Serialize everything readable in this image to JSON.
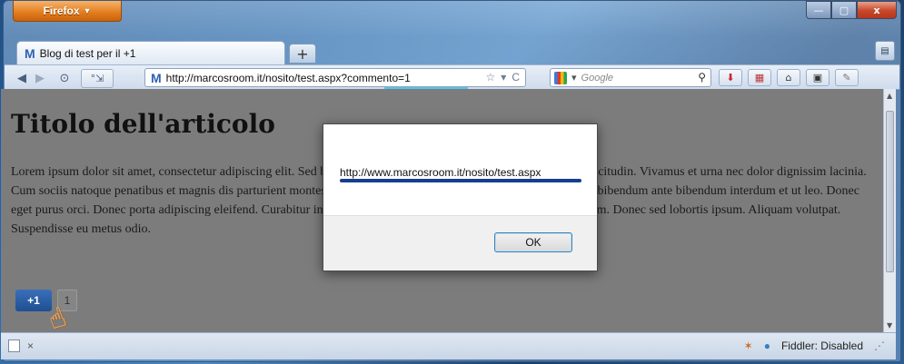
{
  "browser": {
    "app_button": "Firefox",
    "app_caret": "▼",
    "window_controls": {
      "minimize": "—",
      "maximize": "▢",
      "close": "x"
    }
  },
  "tabs": {
    "active_tab_title": "Blog di test per il +1",
    "favicon": "M",
    "new_tab": "+"
  },
  "navbar": {
    "back": "◀",
    "forward": "▶",
    "history": "⊙",
    "bookmark_star": "☆",
    "url": "http://marcosroom.it/nosito/test.aspx?commento=1",
    "url_favicon": "M",
    "dropdown": "▾",
    "reload": "C",
    "search_placeholder": "Google",
    "search_icon": "⚲"
  },
  "page": {
    "title": "Titolo dell'articolo",
    "paragraph": "Lorem ipsum dolor sit amet, consectetur adipiscing elit. Sed blandit feugiat leo, quis ultrices at venenatis nulla sollicitudin. Vivamus et urna nec dolor dignissim lacinia. Cum sociis natoque penatibus et magnis dis parturient montes, nascetur ridiculus mus. Etiam porta dapibus mi, vel bibendum ante bibendum interdum et ut leo. Donec eget purus orci. Donec porta adipiscing eleifend. Curabitur in ante, mattis bibendum feugiat vitae, interdum sed diam. Donec sed lobortis ipsum. Aliquam volutpat. Suspendisse eu metus odio.",
    "plusone_label": "+1",
    "plusone_count": "1"
  },
  "dialog": {
    "message": "http://www.marcosroom.it/nosito/test.aspx",
    "ok_label": "OK"
  },
  "statusbar": {
    "close_x": "×",
    "fiddler": "Fiddler: Disabled"
  }
}
